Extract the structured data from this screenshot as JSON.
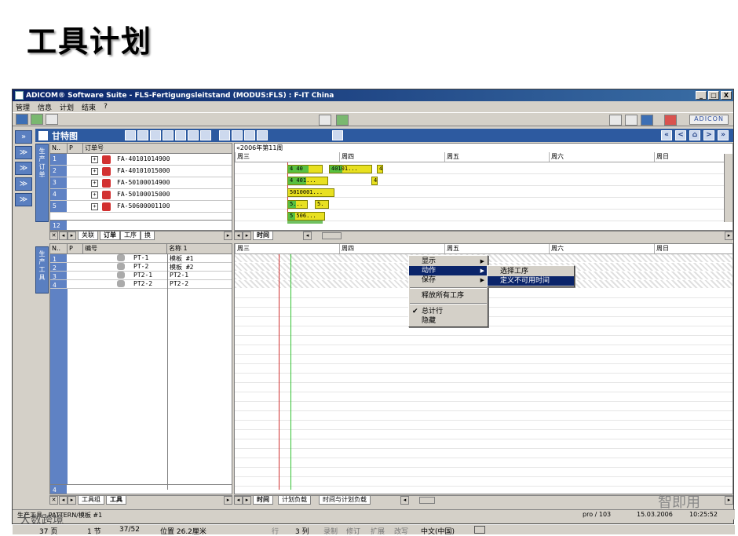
{
  "slide": {
    "title": "工具计划"
  },
  "window": {
    "title": "ADICOM® Software Suite - FLS-Fertigungsleitstand (MODUS:FLS) : F-IT China",
    "min": "_",
    "max": "□",
    "close": "X"
  },
  "menu": [
    "管理",
    "信息",
    "计划",
    "结束",
    "?"
  ],
  "toolbar": {
    "brand": "ADICON"
  },
  "nav": {
    "expand": "»",
    "buttons": [
      "≫",
      "≫",
      "≫",
      "≫"
    ]
  },
  "gantt": {
    "title": "甘特图",
    "nav_buttons": [
      "«",
      "<",
      "⌂",
      ">",
      "»"
    ],
    "orders_tab": "生产订单",
    "orders_header": {
      "n": "N..",
      "p": "P",
      "order_no": "订单号"
    },
    "orders": [
      {
        "n": "1",
        "id": "FA-40101014900"
      },
      {
        "n": "2",
        "id": "FA-40101015000"
      },
      {
        "n": "3",
        "id": "FA-50100014900"
      },
      {
        "n": "4",
        "id": "FA-50100015000"
      },
      {
        "n": "5",
        "id": "FA-50600001100"
      }
    ],
    "orders_count": "12",
    "orders_tabs": [
      "关联",
      "订单",
      "工序",
      "换"
    ],
    "week_label": "«2006年第11周",
    "days": [
      "周三",
      "周四",
      "周五",
      "周六",
      "周日"
    ],
    "bars": [
      {
        "row": 0,
        "label": "4 40"
      },
      {
        "row": 0,
        "label": "40101..."
      },
      {
        "row": 0,
        "label": "4"
      },
      {
        "row": 1,
        "label": "4 401..."
      },
      {
        "row": 1,
        "label": "4"
      },
      {
        "row": 2,
        "label": "5010001..."
      },
      {
        "row": 3,
        "label": "5..."
      },
      {
        "row": 3,
        "label": "5."
      },
      {
        "row": 4,
        "label": "5 506..."
      }
    ],
    "top_timeline_tab": "时间"
  },
  "tools": {
    "tab": "生产工具",
    "header": {
      "n": "N..",
      "p": "P",
      "code": "编号",
      "name": "名称 1"
    },
    "items": [
      {
        "n": "1",
        "code": "PT-1",
        "name": "模板 #1"
      },
      {
        "n": "2",
        "code": "PT-2",
        "name": "模板 #2"
      },
      {
        "n": "3",
        "code": "PT2-1",
        "name": "PT2-1"
      },
      {
        "n": "4",
        "code": "PT2-2",
        "name": "PT2-2"
      }
    ],
    "count": "4",
    "tabs": [
      "工具组",
      "工具"
    ],
    "days": [
      "周三",
      "周四",
      "周五",
      "周六",
      "周日"
    ],
    "timeline_tabs": [
      "时间",
      "计划负载",
      "时间与计划负载"
    ]
  },
  "context_menu": {
    "items": [
      "显示",
      "动作",
      "保存",
      "释放所有工序",
      "总计行",
      "隐藏"
    ],
    "check": "✔",
    "submenu": [
      "选择工序",
      "定义不可用时间"
    ]
  },
  "status1": {
    "left": "生产工具 : PATTERN/模板 #1",
    "right1": "pro / 103",
    "date": "15.03.2006",
    "time": "10:25:52"
  },
  "status2": {
    "page": "37 页",
    "section": "1 节",
    "pos": "37/52",
    "loc": "位置 26.2厘米",
    "row": "行",
    "col": "3 列",
    "rec": "录制",
    "rev": "修订",
    "ext": "扩展",
    "ovr": "改写",
    "lang": "中文(中国)"
  },
  "watermarks": {
    "left": "大数跨境",
    "right": "智即用"
  }
}
